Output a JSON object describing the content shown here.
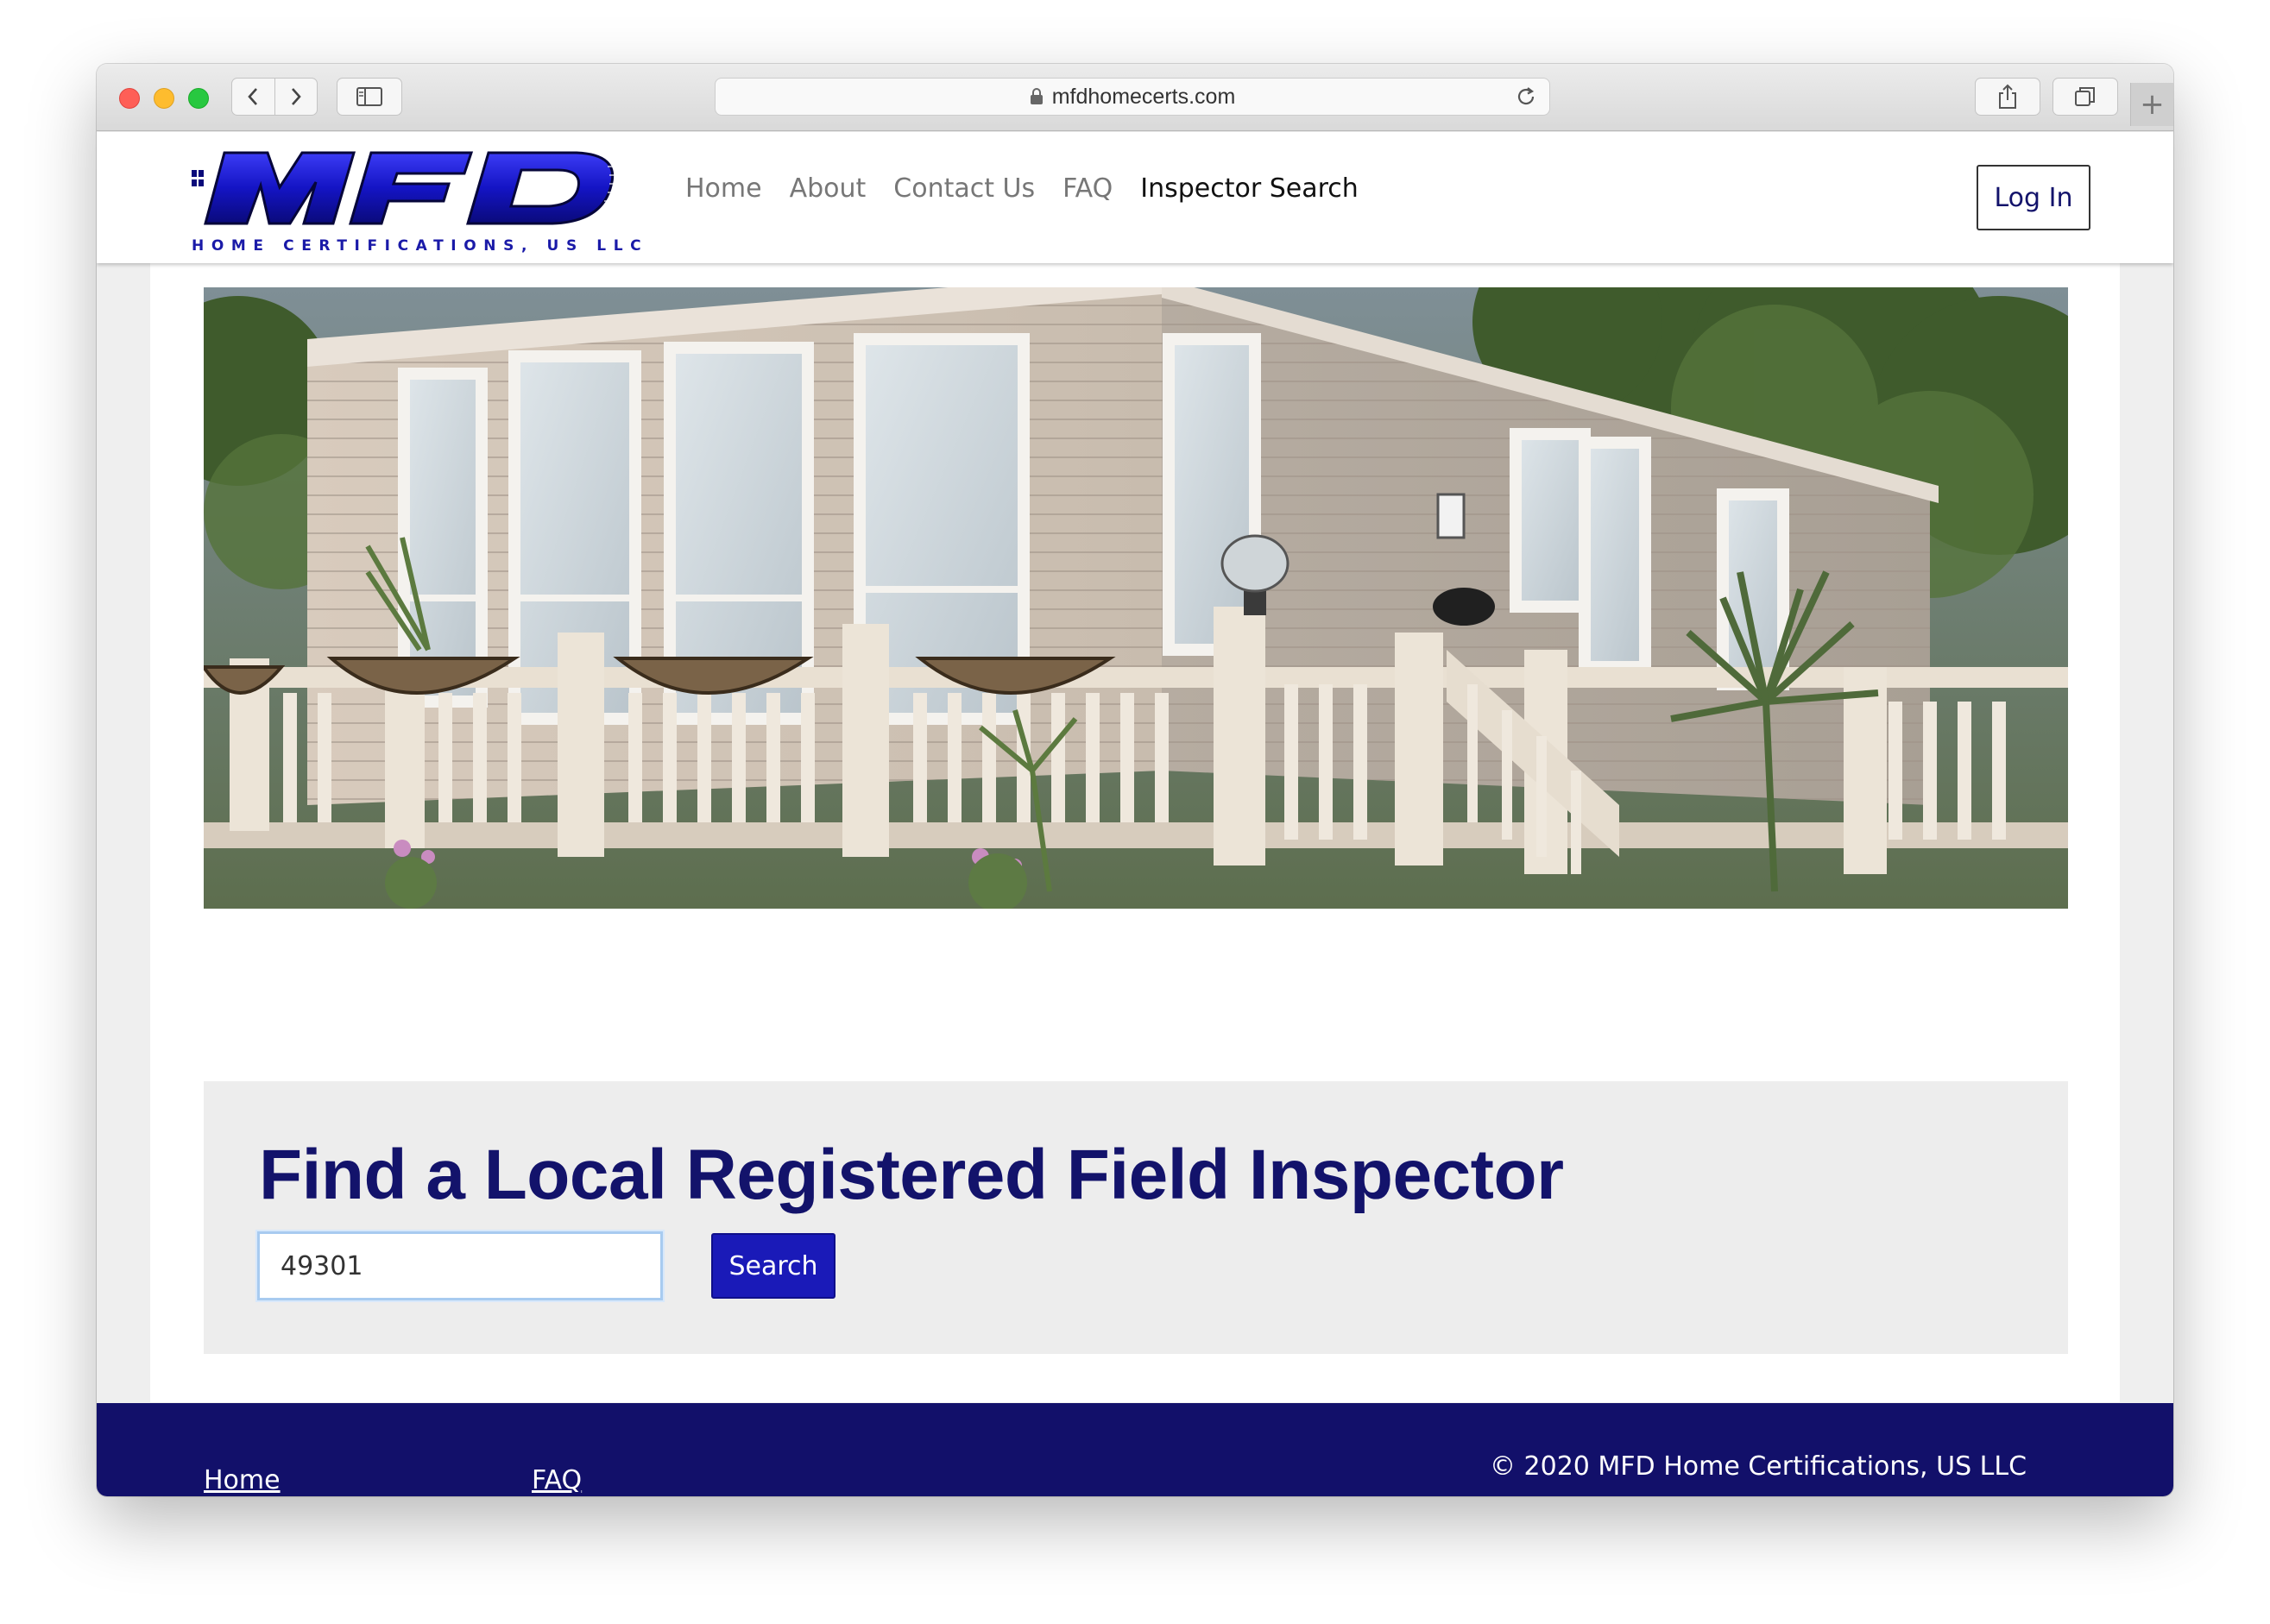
{
  "browser": {
    "url": "mfdhomecerts.com"
  },
  "site": {
    "logo_text": "MFD",
    "logo_tagline": "HOME CERTIFICATIONS, US LLC",
    "nav": [
      {
        "label": "Home"
      },
      {
        "label": "About"
      },
      {
        "label": "Contact Us"
      },
      {
        "label": "FAQ"
      },
      {
        "label": "Inspector Search"
      }
    ],
    "active_nav": "Inspector Search",
    "login_label": "Log In"
  },
  "search": {
    "title": "Find a Local Registered Field Inspector",
    "zip_value": "49301",
    "button_label": "Search"
  },
  "footer": {
    "links": [
      {
        "label": "Home"
      },
      {
        "label": "FAQ"
      }
    ],
    "copyright": "© 2020 MFD Home Certifications, US LLC"
  },
  "colors": {
    "brand_navy": "#13136b",
    "brand_blue": "#1a1ab8",
    "footer_bg": "#12106a"
  }
}
